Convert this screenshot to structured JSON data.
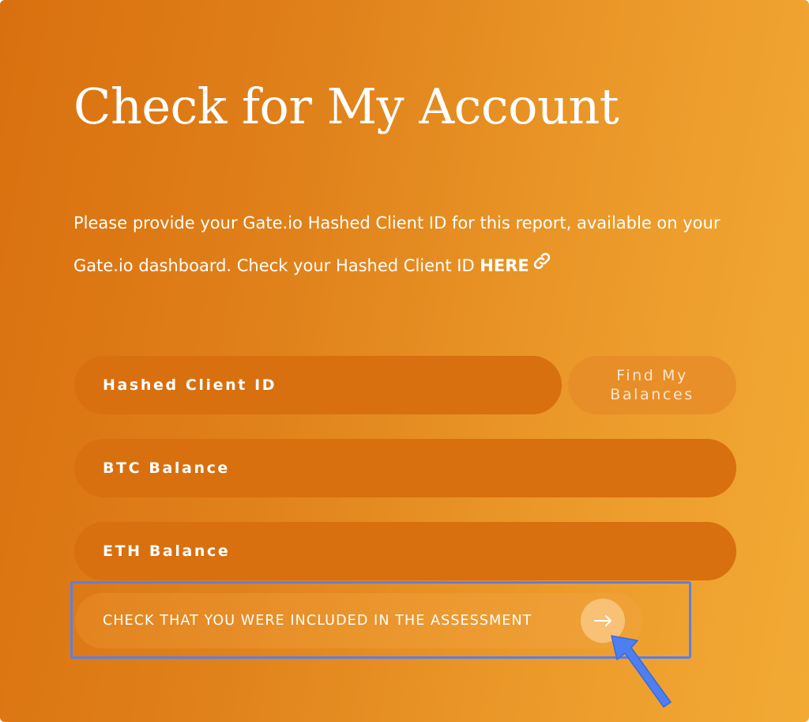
{
  "card": {
    "title": "Check for My Account",
    "description_line1": "Please provide your Gate.io Hashed Client ID for this report, available on your",
    "description_line2": "Gate.io dashboard. Check your Hashed Client ID ",
    "description_link": "HERE",
    "link_icon": "link-icon"
  },
  "form": {
    "hashed_client_id_placeholder": "Hashed Client ID",
    "find_button_label": "Find My Balances",
    "btc_balance_placeholder": "BTC Balance",
    "eth_balance_placeholder": "ETH Balance",
    "check_button_label": "CHECK THAT YOU WERE INCLUDED IN THE ASSESSMENT",
    "check_button_icon": "arrow-right-icon"
  },
  "annotation": {
    "highlight_color": "#5b7fe6",
    "pointer_icon": "pointer-arrow-icon"
  },
  "colors": {
    "gradient_start": "#d9700f",
    "gradient_end": "#f3aa35",
    "field_background": "#d8700f",
    "text": "#ffffff"
  }
}
